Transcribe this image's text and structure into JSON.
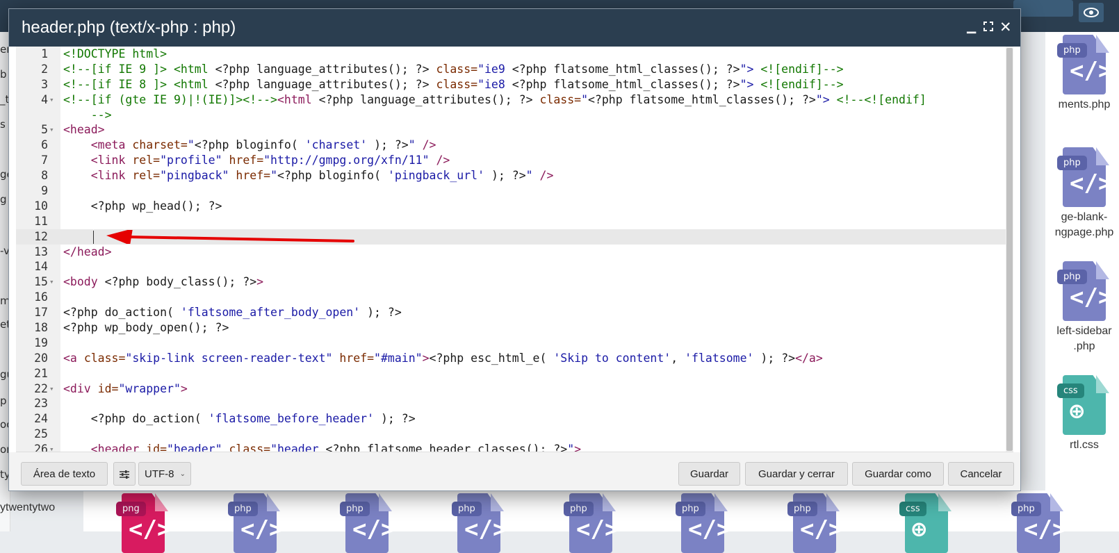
{
  "dialog": {
    "title": "header.php (text/x-php : php)",
    "minimize_icon": "minimize-icon",
    "maximize_icon": "maximize-icon",
    "close_icon": "close-icon"
  },
  "editor": {
    "lines": [
      {
        "n": "1",
        "fold": ""
      },
      {
        "n": "2",
        "fold": ""
      },
      {
        "n": "3",
        "fold": ""
      },
      {
        "n": "4",
        "fold": "▾"
      },
      {
        "n": "",
        "fold": ""
      },
      {
        "n": "5",
        "fold": "▾"
      },
      {
        "n": "6",
        "fold": ""
      },
      {
        "n": "7",
        "fold": ""
      },
      {
        "n": "8",
        "fold": ""
      },
      {
        "n": "9",
        "fold": ""
      },
      {
        "n": "10",
        "fold": ""
      },
      {
        "n": "11",
        "fold": ""
      },
      {
        "n": "12",
        "fold": ""
      },
      {
        "n": "13",
        "fold": ""
      },
      {
        "n": "14",
        "fold": ""
      },
      {
        "n": "15",
        "fold": "▾"
      },
      {
        "n": "16",
        "fold": ""
      },
      {
        "n": "17",
        "fold": ""
      },
      {
        "n": "18",
        "fold": ""
      },
      {
        "n": "19",
        "fold": ""
      },
      {
        "n": "20",
        "fold": ""
      },
      {
        "n": "21",
        "fold": ""
      },
      {
        "n": "22",
        "fold": "▾"
      },
      {
        "n": "23",
        "fold": ""
      },
      {
        "n": "24",
        "fold": ""
      },
      {
        "n": "25",
        "fold": ""
      },
      {
        "n": "26",
        "fold": "▾"
      }
    ],
    "active_line_number": "12",
    "code": [
      [
        [
          "t",
          "<!DOCTYPE html>"
        ]
      ],
      [
        [
          "cm",
          "<!--[if IE 9 ]> "
        ],
        [
          "t",
          "<html "
        ],
        [
          "",
          "<?php language_attributes(); ?> "
        ],
        [
          "at",
          "class="
        ],
        [
          "st",
          "\"ie9 "
        ],
        [
          "",
          "<?php flatsome_html_classes(); ?>"
        ],
        [
          "st",
          "\">"
        ],
        [
          "cm",
          " <![endif]-->"
        ]
      ],
      [
        [
          "cm",
          "<!--[if IE 8 ]> "
        ],
        [
          "t",
          "<html "
        ],
        [
          "",
          "<?php language_attributes(); ?> "
        ],
        [
          "at",
          "class="
        ],
        [
          "st",
          "\"ie8 "
        ],
        [
          "",
          "<?php flatsome_html_classes(); ?>"
        ],
        [
          "st",
          "\">"
        ],
        [
          "cm",
          " <![endif]-->"
        ]
      ],
      [
        [
          "cm",
          "<!--[if (gte IE 9)|!(IE)]><!-->"
        ],
        [
          "kw",
          "<html "
        ],
        [
          "",
          "<?php language_attributes(); ?> "
        ],
        [
          "at",
          "class="
        ],
        [
          "st",
          "\""
        ],
        [
          "",
          "<?php flatsome_html_classes(); ?>"
        ],
        [
          "st",
          "\">"
        ],
        [
          "cm",
          " <!--<![endif]"
        ]
      ],
      [
        [
          "cm",
          "    -->"
        ]
      ],
      [
        [
          "kw",
          "<head>"
        ]
      ],
      [
        [
          "",
          "    "
        ],
        [
          "kw",
          "<meta "
        ],
        [
          "at",
          "charset="
        ],
        [
          "st",
          "\""
        ],
        [
          "",
          "<?php bloginfo( "
        ],
        [
          "str",
          "'charset'"
        ],
        [
          "",
          " ); ?>"
        ],
        [
          "st",
          "\""
        ],
        [
          "kw",
          " />"
        ]
      ],
      [
        [
          "",
          "    "
        ],
        [
          "kw",
          "<link "
        ],
        [
          "at",
          "rel="
        ],
        [
          "st",
          "\"profile\" "
        ],
        [
          "at",
          "href="
        ],
        [
          "st",
          "\"http://gmpg.org/xfn/11\""
        ],
        [
          "kw",
          " />"
        ]
      ],
      [
        [
          "",
          "    "
        ],
        [
          "kw",
          "<link "
        ],
        [
          "at",
          "rel="
        ],
        [
          "st",
          "\"pingback\" "
        ],
        [
          "at",
          "href="
        ],
        [
          "st",
          "\""
        ],
        [
          "",
          "<?php bloginfo( "
        ],
        [
          "str",
          "'pingback_url'"
        ],
        [
          "",
          " ); ?>"
        ],
        [
          "st",
          "\""
        ],
        [
          "kw",
          " />"
        ]
      ],
      [
        [
          "",
          ""
        ]
      ],
      [
        [
          "",
          "    <?php wp_head(); ?>"
        ]
      ],
      [
        [
          "",
          ""
        ]
      ],
      [
        [
          "",
          ""
        ]
      ],
      [
        [
          "kw",
          "</head>"
        ]
      ],
      [
        [
          "",
          ""
        ]
      ],
      [
        [
          "kw",
          "<body "
        ],
        [
          "",
          "<?php body_class(); ?>"
        ],
        [
          "kw",
          ">"
        ]
      ],
      [
        [
          "",
          ""
        ]
      ],
      [
        [
          "",
          "<?php do_action( "
        ],
        [
          "str",
          "'flatsome_after_body_open'"
        ],
        [
          "",
          " ); ?>"
        ]
      ],
      [
        [
          "",
          "<?php wp_body_open(); ?>"
        ]
      ],
      [
        [
          "",
          ""
        ]
      ],
      [
        [
          "kw",
          "<a "
        ],
        [
          "at",
          "class="
        ],
        [
          "st",
          "\"skip-link screen-reader-text\" "
        ],
        [
          "at",
          "href="
        ],
        [
          "st",
          "\"#main\""
        ],
        [
          "kw",
          ">"
        ],
        [
          "",
          "<?php esc_html_e( "
        ],
        [
          "str",
          "'Skip to content'"
        ],
        [
          "",
          ", "
        ],
        [
          "str",
          "'flatsome'"
        ],
        [
          "",
          " ); ?>"
        ],
        [
          "kw",
          "</a>"
        ]
      ],
      [
        [
          "",
          ""
        ]
      ],
      [
        [
          "kw",
          "<div "
        ],
        [
          "at",
          "id="
        ],
        [
          "st",
          "\"wrapper\""
        ],
        [
          "kw",
          ">"
        ]
      ],
      [
        [
          "",
          ""
        ]
      ],
      [
        [
          "",
          "    <?php do_action( "
        ],
        [
          "str",
          "'flatsome_before_header'"
        ],
        [
          "",
          " ); ?>"
        ]
      ],
      [
        [
          "",
          ""
        ]
      ],
      [
        [
          "",
          "    "
        ],
        [
          "kw",
          "<header "
        ],
        [
          "at",
          "id="
        ],
        [
          "st",
          "\"header\" "
        ],
        [
          "at",
          "class="
        ],
        [
          "st",
          "\"header "
        ],
        [
          "",
          "<?php flatsome_header_classes(); ?>"
        ],
        [
          "st",
          "\""
        ],
        [
          "kw",
          ">"
        ]
      ]
    ]
  },
  "footer": {
    "textarea_button": "Área de texto",
    "settings_icon": "sliders-icon",
    "encoding_value": "UTF-8",
    "save": "Guardar",
    "save_close": "Guardar y cerrar",
    "save_as": "Guardar como",
    "cancel": "Cancelar"
  },
  "background": {
    "right_files": [
      {
        "tag": "php",
        "name": "ments.php",
        "type": "php"
      },
      {
        "tag": "php",
        "name": "ge-blank-",
        "name2": "ngpage.php",
        "type": "php"
      },
      {
        "tag": "php",
        "name": "left-sidebar",
        "name2": ".php",
        "type": "php"
      },
      {
        "tag": "css",
        "name": "rtl.css",
        "type": "css"
      }
    ],
    "bottom_files": [
      {
        "tag": "png",
        "type": "png"
      },
      {
        "tag": "php",
        "type": "php"
      },
      {
        "tag": "php",
        "type": "php"
      },
      {
        "tag": "php",
        "type": "php"
      },
      {
        "tag": "php",
        "type": "php"
      },
      {
        "tag": "php",
        "type": "php"
      },
      {
        "tag": "php",
        "type": "php"
      },
      {
        "tag": "css",
        "type": "css"
      },
      {
        "tag": "php",
        "type": "php"
      }
    ],
    "left_fragments": [
      "er",
      "b",
      "_t",
      "s",
      "ge",
      "g",
      "-v",
      "m",
      "et",
      "gu",
      "p",
      "oc",
      "on",
      "ty"
    ],
    "bottom_text": "ytwentytwo"
  }
}
